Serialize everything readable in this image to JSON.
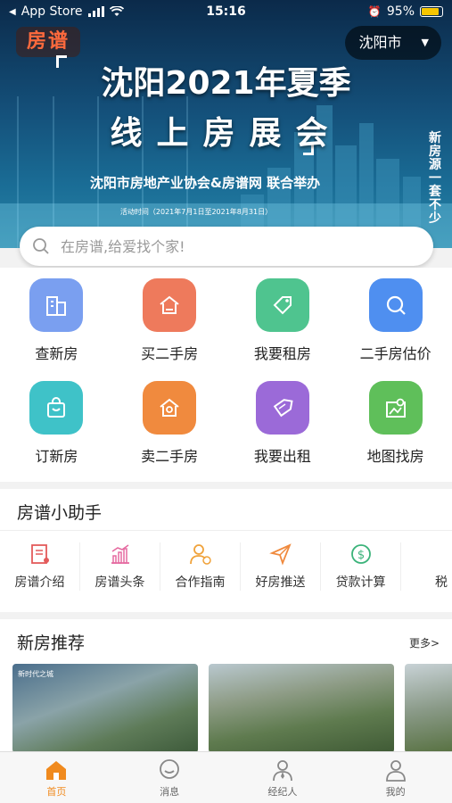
{
  "status_bar": {
    "back_app": "App Store",
    "time": "15:16",
    "battery": "95%"
  },
  "header": {
    "logo": "房谱",
    "city": "沈阳市"
  },
  "banner": {
    "title_line1": "沈阳2021年夏季",
    "title_line2": "线上房展会",
    "organizers": "沈阳市房地产业协会&房谱网 联合举办",
    "date": "活动时间（2021年7月1日至2021年8月31日）",
    "side_text": "新房源一套不少"
  },
  "search": {
    "placeholder": "在房谱,给爱找个家!"
  },
  "grid": [
    {
      "label": "查新房",
      "icon": "building-icon",
      "color": "#7a9ff0"
    },
    {
      "label": "买二手房",
      "icon": "house-hand-icon",
      "color": "#ee7a5c"
    },
    {
      "label": "我要租房",
      "icon": "tag-icon",
      "color": "#4fc48f"
    },
    {
      "label": "二手房估价",
      "icon": "magnifier-icon",
      "color": "#4f8ff0"
    },
    {
      "label": "订新房",
      "icon": "shopping-bag-icon",
      "color": "#3fc2c8"
    },
    {
      "label": "卖二手房",
      "icon": "house-search-icon",
      "color": "#f08a3e"
    },
    {
      "label": "我要出租",
      "icon": "rent-tag-icon",
      "color": "#9b6ad8"
    },
    {
      "label": "地图找房",
      "icon": "map-icon",
      "color": "#5fbf5a"
    }
  ],
  "helper": {
    "title": "房谱小助手",
    "items": [
      {
        "label": "房谱介绍",
        "icon": "document-icon",
        "color": "#e35b5b"
      },
      {
        "label": "房谱头条",
        "icon": "chart-icon",
        "color": "#e56aa0"
      },
      {
        "label": "合作指南",
        "icon": "person-icon",
        "color": "#f0a23a"
      },
      {
        "label": "好房推送",
        "icon": "paper-plane-icon",
        "color": "#f08a3e"
      },
      {
        "label": "贷款计算",
        "icon": "dollar-icon",
        "color": "#3bb37a"
      },
      {
        "label": "税",
        "icon": "tax-icon",
        "color": "#333333"
      }
    ]
  },
  "recommend": {
    "title": "新房推荐",
    "more": "更多>",
    "card1_tag": "新时代之城"
  },
  "tabbar": [
    {
      "label": "首页",
      "icon": "home-icon",
      "active": true
    },
    {
      "label": "消息",
      "icon": "chat-bubble-icon",
      "active": false
    },
    {
      "label": "经纪人",
      "icon": "agent-icon",
      "active": false
    },
    {
      "label": "我的",
      "icon": "user-icon",
      "active": false
    }
  ]
}
